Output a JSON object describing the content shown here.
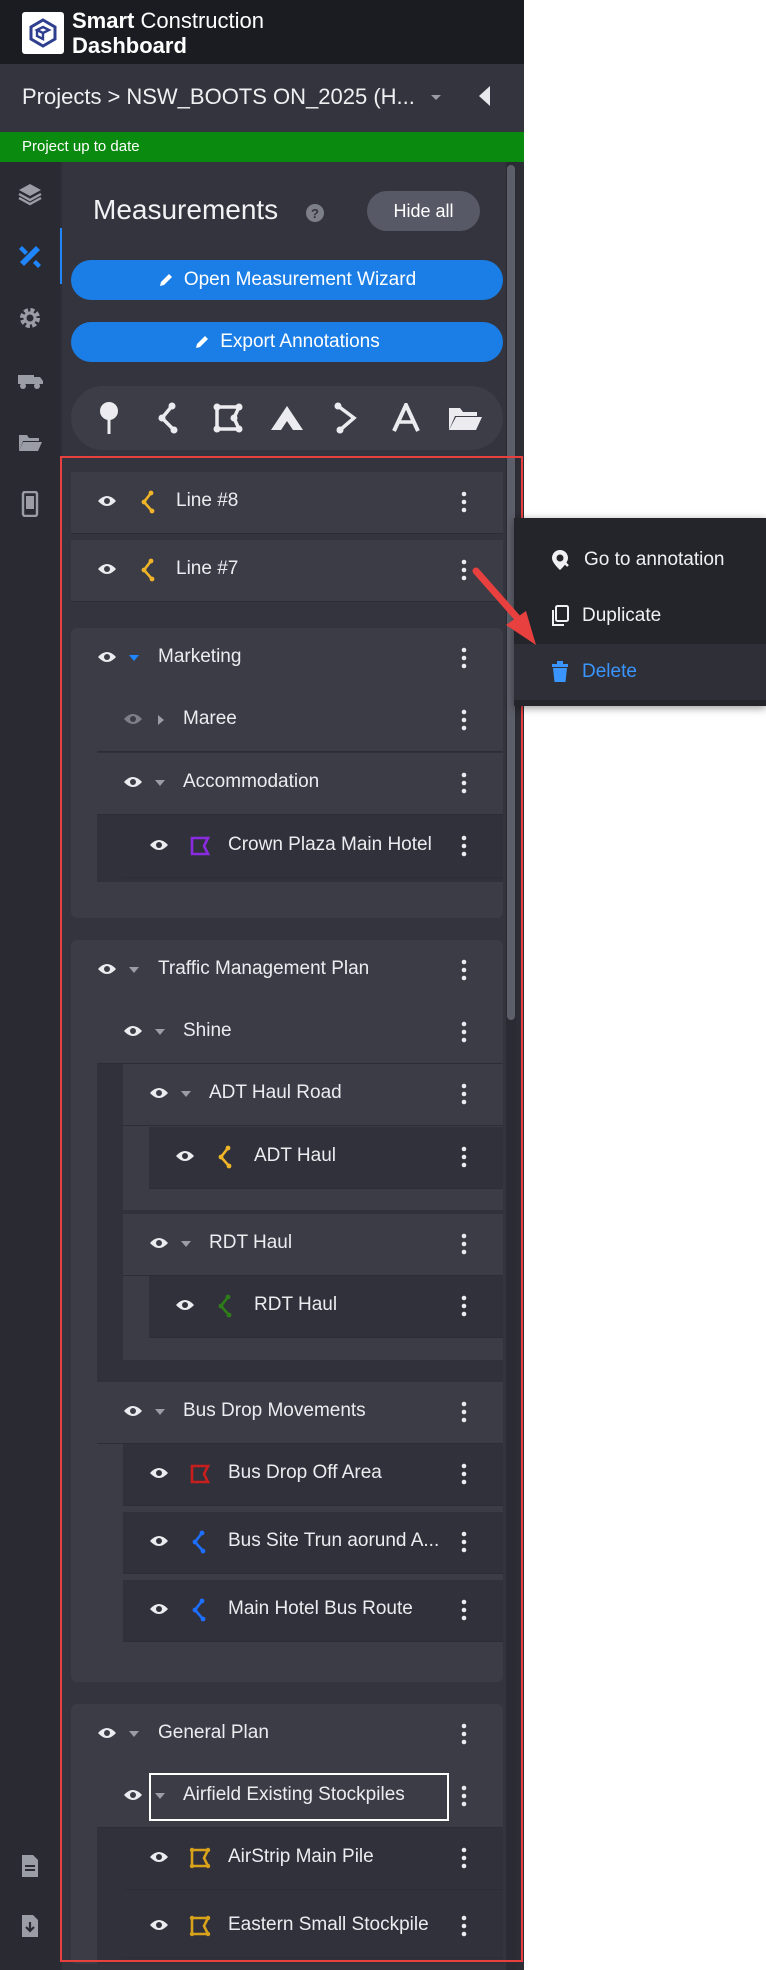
{
  "app": {
    "brand_bold": "Smart",
    "brand_regular": " Construction",
    "brand_line2": "Dashboard"
  },
  "breadcrumb": {
    "root": "Projects",
    "separator": ">",
    "project": "NSW_BOOTS ON_2025 (H..."
  },
  "status": "Project up to date",
  "panel": {
    "title": "Measurements",
    "help": "?",
    "hide_all": "Hide all",
    "wizard": "Open Measurement Wizard",
    "export": "Export Annotations"
  },
  "rows": {
    "line8": "Line #8",
    "line7": "Line #7",
    "marketing": "Marketing",
    "maree": "Maree",
    "accommodation": "Accommodation",
    "crown": "Crown Plaza Main Hotel",
    "tmp": "Traffic Management Plan",
    "shine": "Shine",
    "adt_road": "ADT Haul Road",
    "adt_haul": "ADT Haul",
    "rdt_group": "RDT Haul",
    "rdt_haul": "RDT Haul",
    "bus_drop": "Bus Drop Movements",
    "bus_off": "Bus Drop Off Area",
    "bus_site": "Bus Site Trun aorund A...",
    "hotel_route": "Main Hotel Bus Route",
    "general": "General Plan",
    "airfield": "Airfield Existing Stockpiles",
    "airstrip": "AirStrip Main Pile",
    "eastern": "Eastern Small Stockpile"
  },
  "context_menu": {
    "goto": "Go to annotation",
    "duplicate": "Duplicate",
    "delete": "Delete"
  },
  "colors": {
    "accent": "#1a7ee6",
    "status_green": "#0a8a0e",
    "line_yellow": "#f0b429",
    "crown_purple": "#8a2be2",
    "rdt_green": "#2f7d1a",
    "bus_red": "#c81e1e",
    "route_blue": "#1e6fff",
    "stockpile_gold": "#d9a21b",
    "highlight_frame": "#e8403e"
  }
}
